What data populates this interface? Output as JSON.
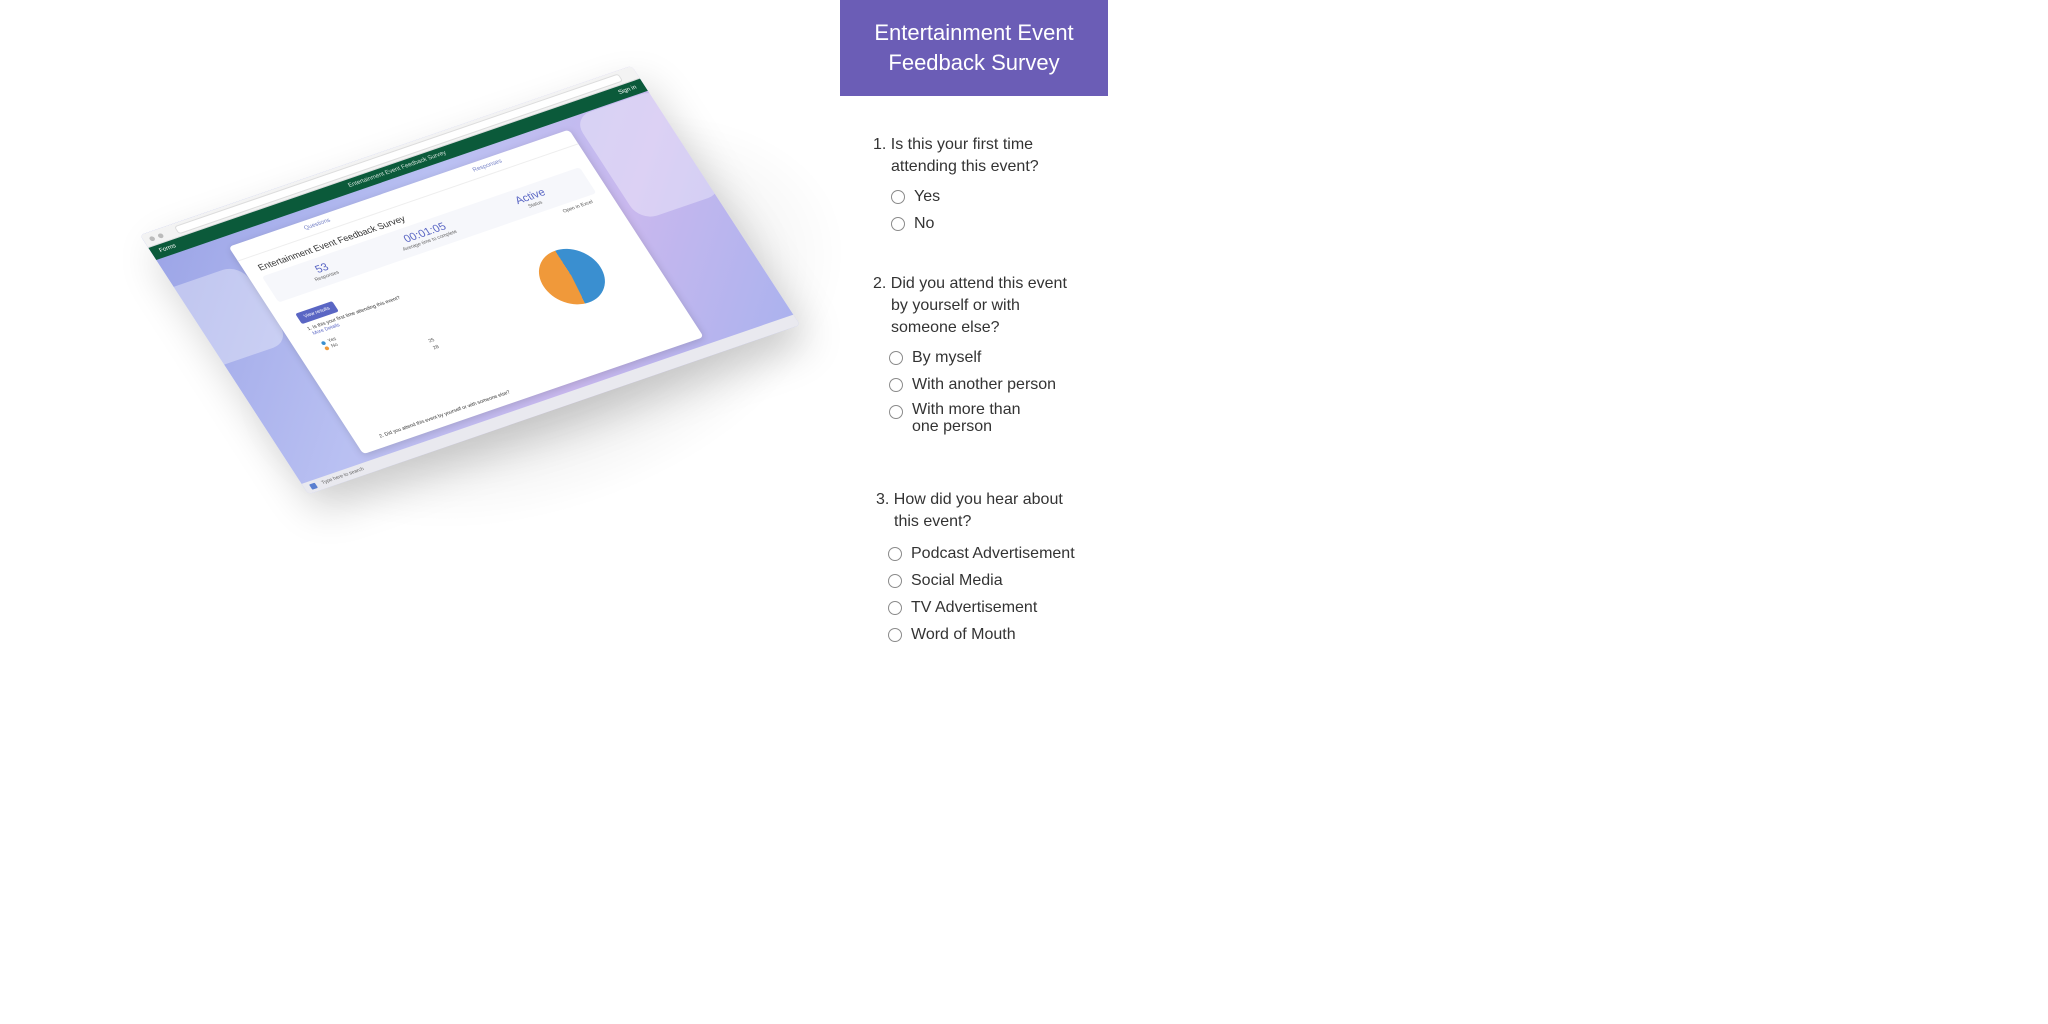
{
  "screenshot": {
    "tabs": [
      "Questions",
      "Responses"
    ],
    "forms_app_label": "Forms",
    "forms_bar_title": "Entertainment Event Feedback Survey",
    "forms_user": "Sign in",
    "card_title": "Entertainment Event Feedback Survey",
    "stats": [
      {
        "value": "53",
        "label": "Responses"
      },
      {
        "value": "00:01:05",
        "label": "Average time to complete"
      },
      {
        "value": "Active",
        "label": "Status"
      }
    ],
    "open_excel": "Open in Excel",
    "view_results_button": "View results",
    "q1": "1. Is this your first time attending this event?",
    "more_details": "More Details",
    "legend": [
      {
        "label": "Yes",
        "count": "25",
        "color": "#3a8fd0"
      },
      {
        "label": "No",
        "count": "28",
        "color": "#f0993a"
      }
    ],
    "q2": "2. Did you attend this event by yourself or with someone else?",
    "taskbar_search": "Type here to search"
  },
  "survey": {
    "title_line1": "Entertainment Event",
    "title_line2": "Feedback Survey",
    "questions": [
      {
        "line1": "1. Is this your first time",
        "line2": "attending this event?",
        "options": [
          "Yes",
          "No"
        ]
      },
      {
        "line1": "2. Did you attend this event",
        "line2": "by yourself or with",
        "line3": "someone else?",
        "options": [
          "By myself",
          "With another person",
          "With more than",
          "one person"
        ]
      },
      {
        "line1": "3. How did you hear about",
        "line2": "this event?",
        "options": [
          "Podcast Advertisement",
          "Social Media",
          "TV Advertisement",
          "Word of Mouth"
        ]
      }
    ]
  },
  "colors": {
    "header_purple": "#6b5db6",
    "forms_green": "#0b5a3a",
    "pie_blue": "#3a8fd0",
    "pie_orange": "#f0993a"
  }
}
